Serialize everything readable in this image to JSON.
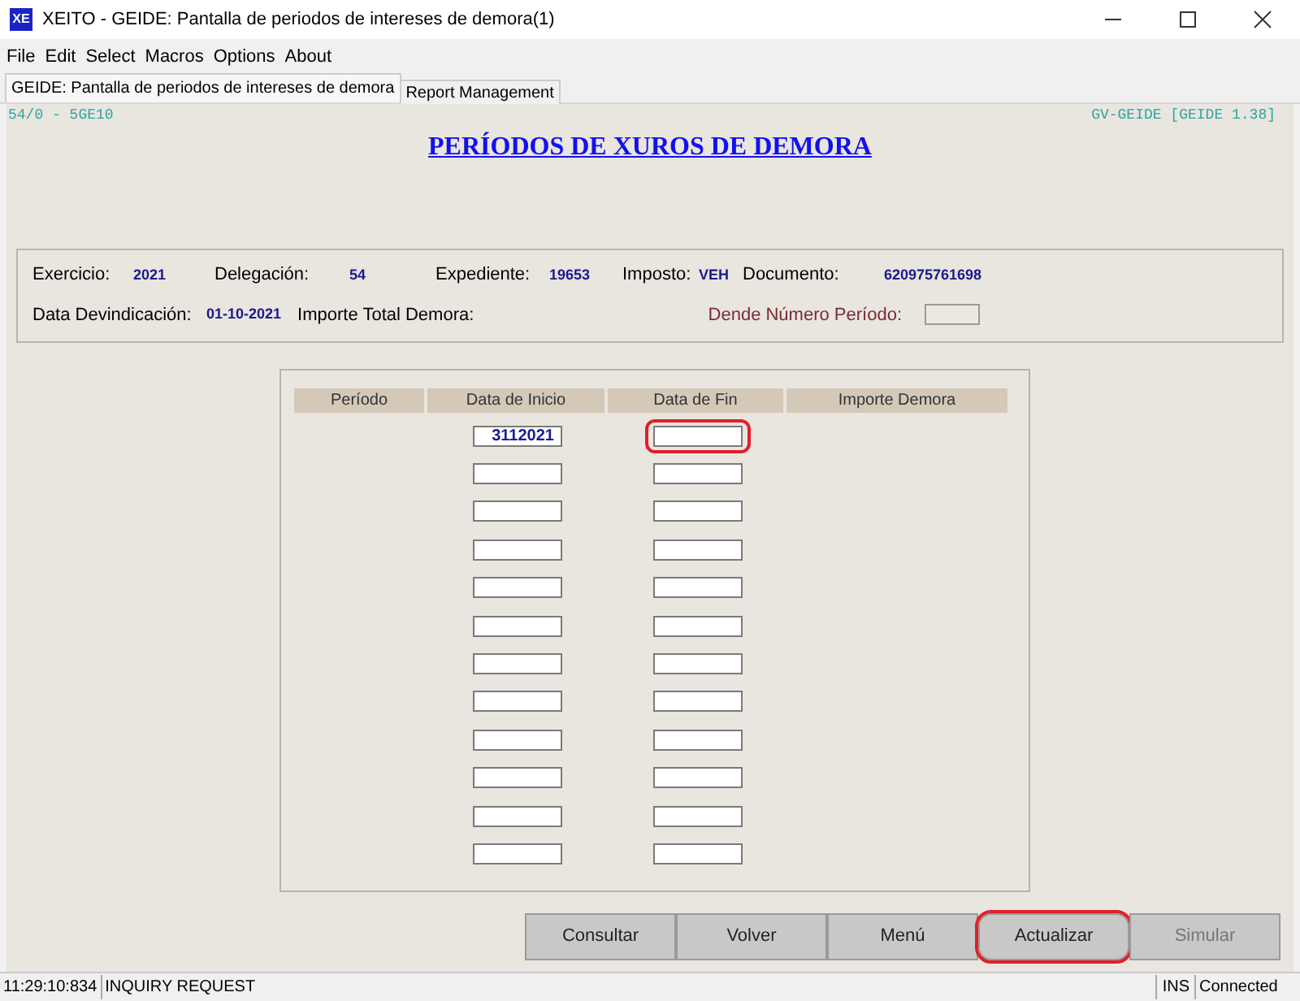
{
  "window": {
    "app_badge": "XE",
    "title": "XEITO - GEIDE: Pantalla de periodos de intereses de demora(1)"
  },
  "menu": [
    "File",
    "Edit",
    "Select",
    "Macros",
    "Options",
    "About"
  ],
  "tabs": [
    {
      "label": "GEIDE: Pantalla de periodos de intereses de demora",
      "selected": true
    },
    {
      "label": "Report Management",
      "selected": false
    }
  ],
  "screen_code": "54/0 - 5GE10",
  "program_id": "GV-GEIDE [GEIDE 1.38]",
  "heading": "PERÍODOS DE XUROS DE DEMORA",
  "info": {
    "row1": [
      {
        "label": "Exercicio:",
        "value": "2021"
      },
      {
        "label": "Delegación:",
        "value": "54"
      },
      {
        "label": "Expediente:",
        "value": "19653"
      },
      {
        "label": "Imposto:",
        "value": "VEH"
      },
      {
        "label": "Documento:",
        "value": "620975761698"
      }
    ],
    "row2": [
      {
        "label": "Data Devindicación:",
        "value": "01-10-2021"
      },
      {
        "label": "Importe Total Demora:"
      }
    ],
    "period_field_label": "Dende Número Período:"
  },
  "table": {
    "columns": [
      "Período",
      "Data de Inicio",
      "Data de Fin",
      "Importe Demora"
    ],
    "rows": [
      {
        "start": "3112021",
        "end_highlighted": true
      },
      {
        "end_highlighted": false
      },
      {
        "end_highlighted": false
      },
      {
        "end_highlighted": false
      },
      {
        "end_highlighted": false
      },
      {
        "end_highlighted": false
      },
      {
        "end_highlighted": false
      },
      {
        "end_highlighted": false
      },
      {
        "end_highlighted": false
      },
      {
        "end_highlighted": false
      },
      {
        "end_highlighted": false
      },
      {
        "end_highlighted": false
      }
    ]
  },
  "buttons": [
    {
      "label": "Consultar",
      "disabled": false,
      "highlighted": false
    },
    {
      "label": "Volver",
      "disabled": false,
      "highlighted": false
    },
    {
      "label": "Menú",
      "disabled": false,
      "highlighted": false
    },
    {
      "label": "Actualizar",
      "disabled": false,
      "highlighted": true
    },
    {
      "label": "Simular",
      "disabled": true,
      "highlighted": false
    }
  ],
  "status_bar": {
    "time": "11:29:10:834",
    "message": "INQUIRY REQUEST",
    "mode": "INS",
    "connection": "Connected"
  }
}
